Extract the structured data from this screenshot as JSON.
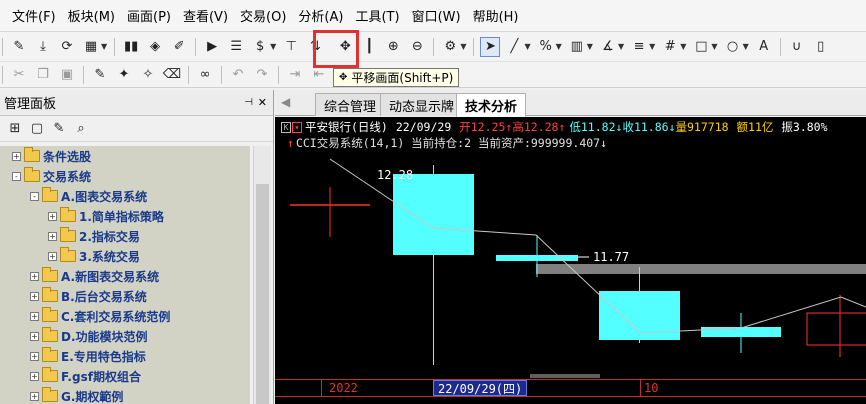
{
  "menu": [
    "文件(F)",
    "板块(M)",
    "画面(P)",
    "查看(V)",
    "交易(O)",
    "分析(A)",
    "工具(T)",
    "窗口(W)",
    "帮助(H)"
  ],
  "toolbar": {
    "tooltip_text": "平移画面(Shift+P)",
    "pan_tool_icon": "move-arrows-icon",
    "highlight_color": "#e03030"
  },
  "left_panel": {
    "title": "管理面板",
    "tree": [
      {
        "label": "条件选股",
        "level": 0,
        "expander": "+"
      },
      {
        "label": "交易系统",
        "level": 0,
        "expander": "-"
      },
      {
        "label": "A.图表交易系统",
        "level": 1,
        "expander": "-"
      },
      {
        "label": "1.简单指标策略",
        "level": 2,
        "expander": "+"
      },
      {
        "label": "2.指标交易",
        "level": 2,
        "expander": "+"
      },
      {
        "label": "3.系统交易",
        "level": 2,
        "expander": "+"
      },
      {
        "label": "A.新图表交易系统",
        "level": 1,
        "expander": "+"
      },
      {
        "label": "B.后台交易系统",
        "level": 1,
        "expander": "+"
      },
      {
        "label": "C.套利交易系统范例",
        "level": 1,
        "expander": "+"
      },
      {
        "label": "D.功能模块范例",
        "level": 1,
        "expander": "+"
      },
      {
        "label": "E.专用特色指标",
        "level": 1,
        "expander": "+"
      },
      {
        "label": "F.gsf期权组合",
        "level": 1,
        "expander": "+"
      },
      {
        "label": "G.期权範例",
        "level": 1,
        "expander": "+"
      }
    ]
  },
  "tabs": [
    {
      "label": "综合管理",
      "active": false
    },
    {
      "label": "动态显示牌",
      "active": false
    },
    {
      "label": "技术分析",
      "active": true
    }
  ],
  "chart_header": {
    "symbol": "平安银行(日线)",
    "date": "22/09/29",
    "open_label": "开",
    "open": "12.25",
    "high_label": "高",
    "high": "12.28",
    "low_label": "低",
    "low": "11.82",
    "close_label": "收",
    "close": "11.86",
    "volume_label": "量",
    "volume": "917718",
    "amount_label": "额",
    "amount": "11亿",
    "amplitude_label": "振",
    "amplitude": "3.80%",
    "system_line": "CCI交易系统(14,1) 当前持仓:2 当前资产:999999.407"
  },
  "chart_data": {
    "type": "candlestick",
    "labels": {
      "high_tag": "12.28",
      "low_tag": "11.77"
    },
    "dates_axis": [
      "2022",
      "22/09/29(四)",
      "10"
    ],
    "colors": {
      "up": "#ff3030",
      "down": "#54ffff",
      "line": "#c8c8c8",
      "band": "#808080"
    }
  }
}
